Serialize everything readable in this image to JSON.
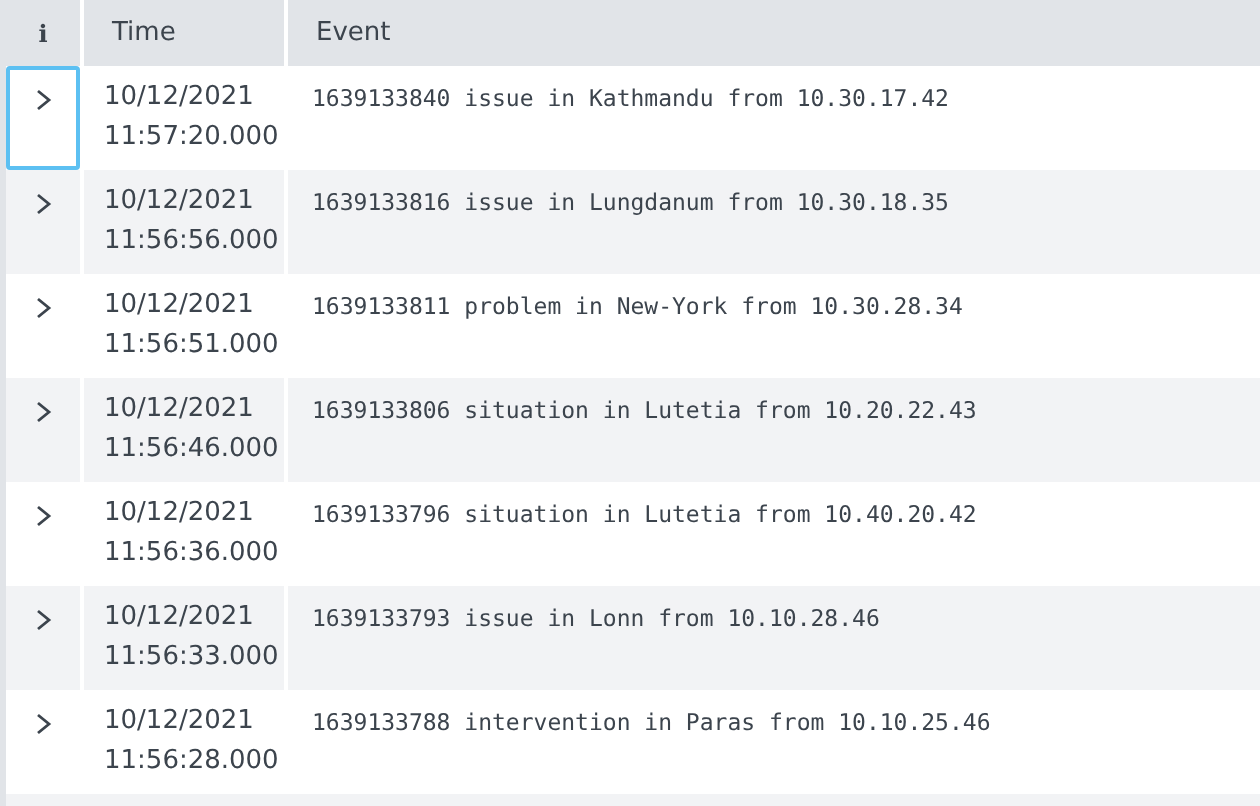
{
  "table": {
    "columns": [
      {
        "label": "i",
        "kind": "info"
      },
      {
        "label": "Time",
        "kind": "text"
      },
      {
        "label": "Event",
        "kind": "text"
      }
    ],
    "rows": [
      {
        "date": "10/12/2021",
        "time": "11:57:20.000",
        "event": "1639133840 issue in Kathmandu from 10.30.17.42",
        "focused": true
      },
      {
        "date": "10/12/2021",
        "time": "11:56:56.000",
        "event": "1639133816 issue in Lungdanum from 10.30.18.35",
        "focused": false
      },
      {
        "date": "10/12/2021",
        "time": "11:56:51.000",
        "event": "1639133811 problem in New-York from 10.30.28.34",
        "focused": false
      },
      {
        "date": "10/12/2021",
        "time": "11:56:46.000",
        "event": "1639133806 situation in Lutetia from 10.20.22.43",
        "focused": false
      },
      {
        "date": "10/12/2021",
        "time": "11:56:36.000",
        "event": "1639133796 situation in Lutetia from 10.40.20.42",
        "focused": false
      },
      {
        "date": "10/12/2021",
        "time": "11:56:33.000",
        "event": "1639133793 issue in Lonn from 10.10.28.46",
        "focused": false
      },
      {
        "date": "10/12/2021",
        "time": "11:56:28.000",
        "event": "1639133788 intervention in Paras from 10.10.25.46",
        "focused": false
      }
    ]
  }
}
